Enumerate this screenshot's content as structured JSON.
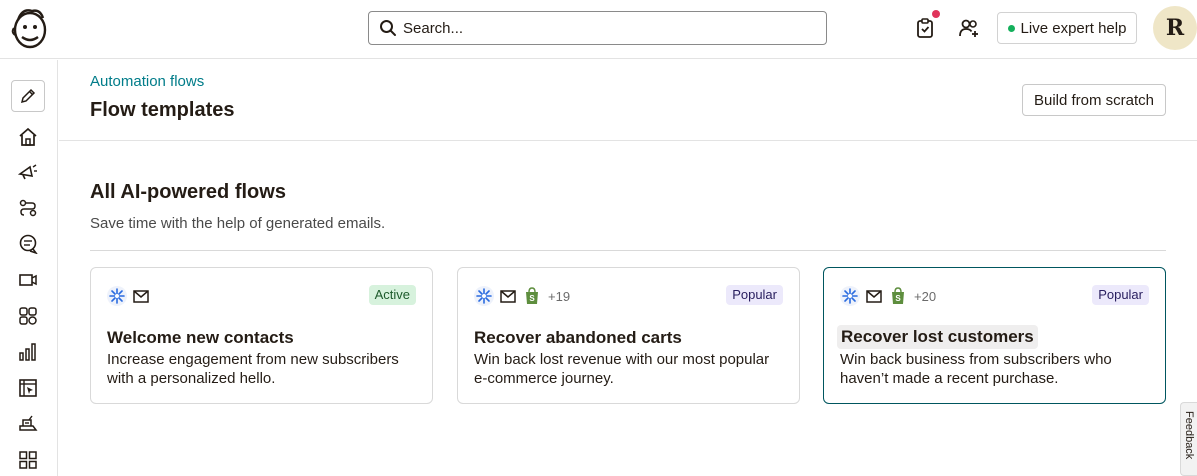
{
  "topbar": {
    "logo_icon": "mailchimp-freddie-icon",
    "search_placeholder": "Search...",
    "live_help_label": "Live expert help",
    "avatar_initial": "R",
    "colors": {
      "notification_dot": "#e0345b",
      "live_dot": "#14b05c"
    }
  },
  "sidebar": {
    "items": [
      {
        "icon": "pencil-icon"
      },
      {
        "icon": "home-icon"
      },
      {
        "icon": "megaphone-icon"
      },
      {
        "icon": "automation-icon"
      },
      {
        "icon": "chat-icon"
      },
      {
        "icon": "website-icon"
      },
      {
        "icon": "audience-icon"
      },
      {
        "icon": "analytics-icon"
      },
      {
        "icon": "content-icon"
      },
      {
        "icon": "integrations-icon"
      },
      {
        "icon": "grid-icon"
      }
    ]
  },
  "header": {
    "breadcrumb": "Automation flows",
    "title": "Flow templates",
    "build_button": "Build from scratch"
  },
  "section": {
    "title": "All AI-powered flows",
    "subtitle": "Save time with the help of generated emails."
  },
  "cards": [
    {
      "title": "Welcome new contacts",
      "description": "Increase engagement from new subscribers with a personalized hello.",
      "badge": "Active",
      "more_count": ""
    },
    {
      "title": "Recover abandoned carts",
      "description": "Win back lost revenue with our most popular e-commerce journey.",
      "badge": "Popular",
      "more_count": "+19"
    },
    {
      "title": "Recover lost customers",
      "description": "Win back business from subscribers who haven’t made a recent purchase.",
      "badge": "Popular",
      "more_count": "+20"
    }
  ],
  "feedback_label": "Feedback",
  "colors": {
    "accent": "#007c89",
    "selected_border": "#00565f",
    "active_badge": "#d7f2dd",
    "popular_badge": "#ece9fb"
  }
}
